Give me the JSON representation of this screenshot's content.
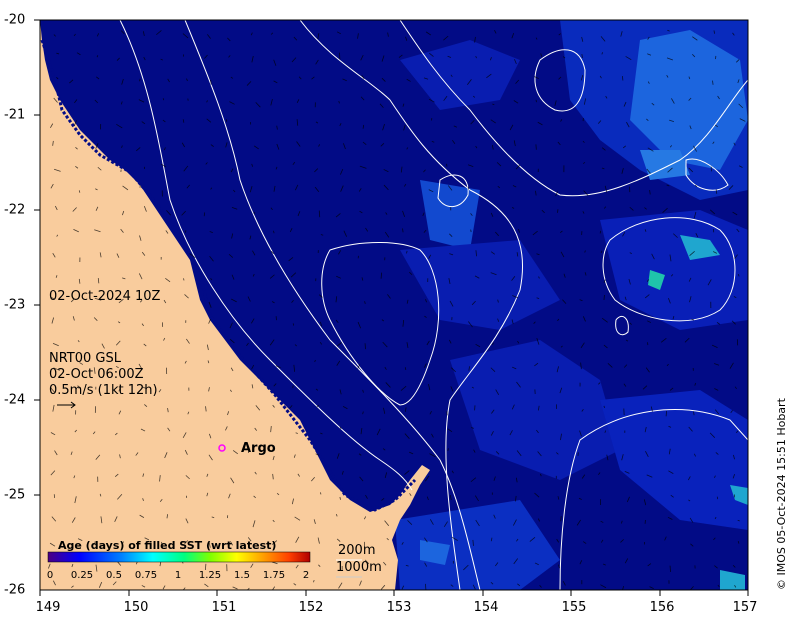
{
  "map": {
    "x_ticks": [
      "149",
      "150",
      "151",
      "152",
      "153",
      "154",
      "155",
      "156",
      "157"
    ],
    "y_ticks": [
      "-20",
      "-21",
      "-22",
      "-23",
      "-24",
      "-25",
      "-26"
    ],
    "colors": {
      "land": "#f9cc9d",
      "ocean_dark": "#020b86",
      "ocean_mid": "#0a1fb5",
      "ocean_light": "#1f6fe8",
      "ocean_cyan": "#23b7d8"
    }
  },
  "labels": {
    "date": "02-Oct-2024 10Z",
    "current_model": "NRT00 GSL",
    "current_time": "02-Oct 06:00Z",
    "scale_vector": "0.5m/s (1kt 12h)",
    "argo": "Argo",
    "depth_200": "200m",
    "depth_1000": "1000m",
    "credit": "© IMOS 05-Oct-2024 15:51 Hobart"
  },
  "colorbar": {
    "title": "Age (days) of filled SST (wrt latest)",
    "ticks": [
      "0",
      "0.25",
      "0.5",
      "0.75",
      "1",
      "1.25",
      "1.5",
      "1.75",
      "2"
    ],
    "colors": [
      "#4b0082",
      "#0000ff",
      "#0080ff",
      "#00ffff",
      "#00ff80",
      "#80ff00",
      "#ffff00",
      "#ffa000",
      "#ff4000",
      "#b00000"
    ]
  }
}
